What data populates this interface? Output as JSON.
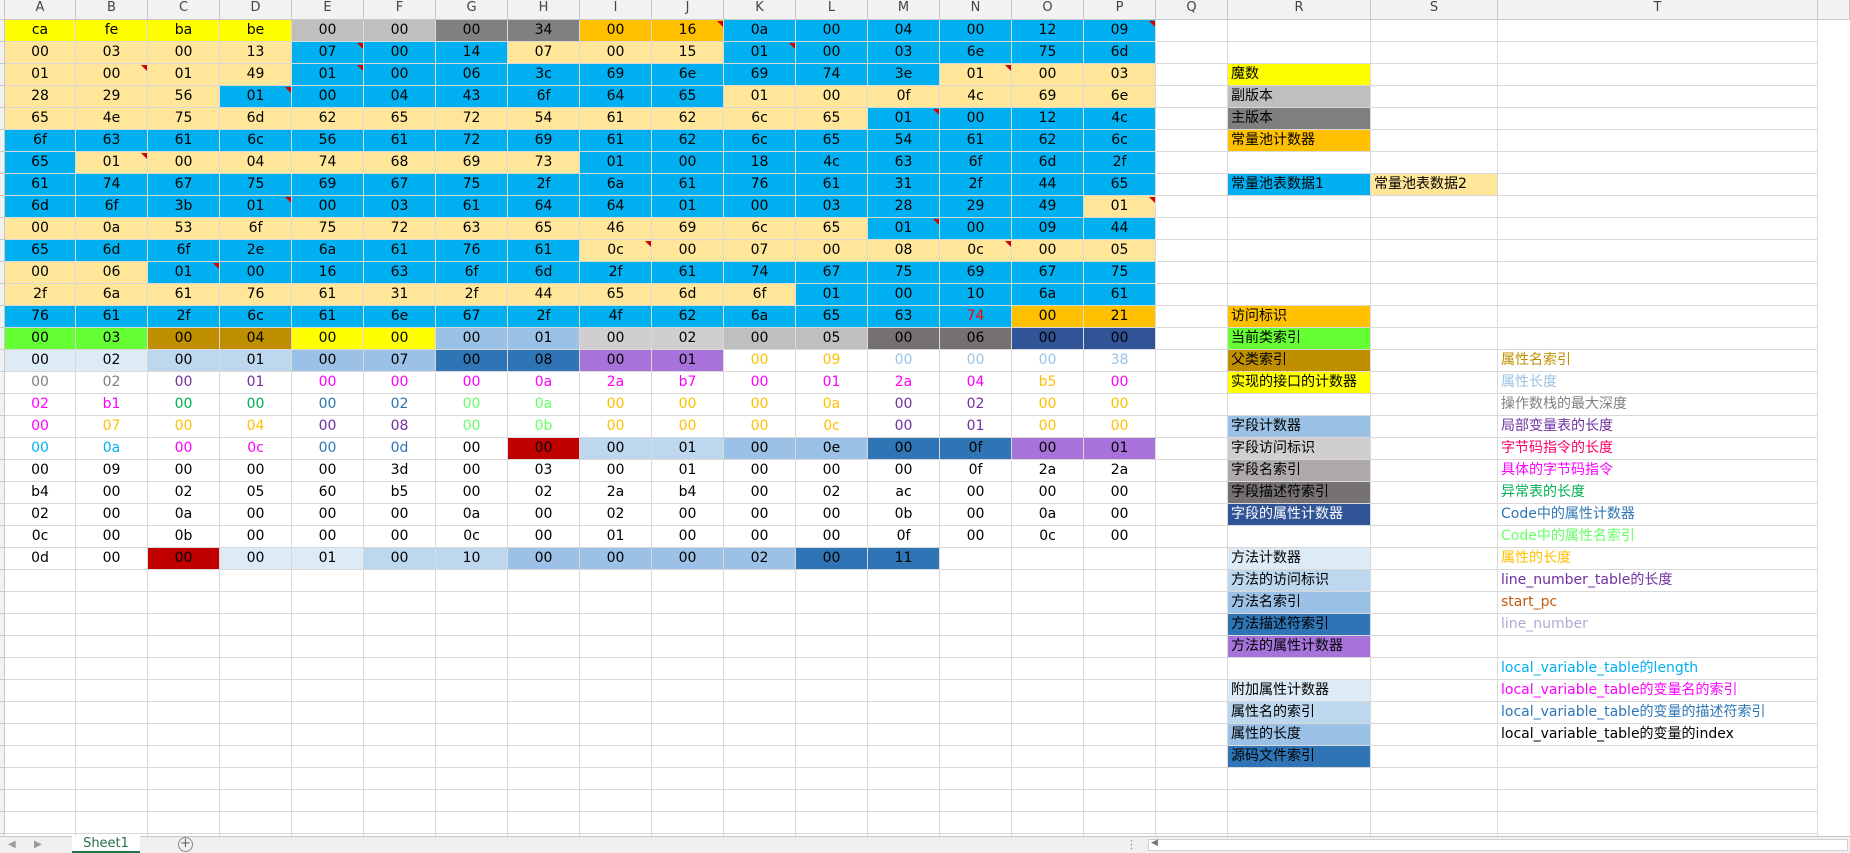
{
  "app": {
    "sheet_tab": "Sheet1",
    "add_sheet_icon": "+",
    "nav_prev_icon": "◀",
    "nav_next_icon": "▶",
    "scroll_dots": "⋮"
  },
  "columns": [
    "A",
    "B",
    "C",
    "D",
    "E",
    "F",
    "G",
    "H",
    "I",
    "J",
    "K",
    "L",
    "M",
    "N",
    "O",
    "P",
    "Q",
    "R",
    "S",
    "T"
  ],
  "grid": {
    "rows": [
      [
        "ca",
        "fe",
        "ba",
        "be",
        "00",
        "00",
        "00",
        "34",
        "00",
        "16",
        "0a",
        "00",
        "04",
        "00",
        "12",
        "09"
      ],
      [
        "00",
        "03",
        "00",
        "13",
        "07",
        "00",
        "14",
        "07",
        "00",
        "15",
        "01",
        "00",
        "03",
        "6e",
        "75",
        "6d"
      ],
      [
        "01",
        "00",
        "01",
        "49",
        "01",
        "00",
        "06",
        "3c",
        "69",
        "6e",
        "69",
        "74",
        "3e",
        "01",
        "00",
        "03"
      ],
      [
        "28",
        "29",
        "56",
        "01",
        "00",
        "04",
        "43",
        "6f",
        "64",
        "65",
        "01",
        "00",
        "0f",
        "4c",
        "69",
        "6e"
      ],
      [
        "65",
        "4e",
        "75",
        "6d",
        "62",
        "65",
        "72",
        "54",
        "61",
        "62",
        "6c",
        "65",
        "01",
        "00",
        "12",
        "4c"
      ],
      [
        "6f",
        "63",
        "61",
        "6c",
        "56",
        "61",
        "72",
        "69",
        "61",
        "62",
        "6c",
        "65",
        "54",
        "61",
        "62",
        "6c"
      ],
      [
        "65",
        "01",
        "00",
        "04",
        "74",
        "68",
        "69",
        "73",
        "01",
        "00",
        "18",
        "4c",
        "63",
        "6f",
        "6d",
        "2f"
      ],
      [
        "61",
        "74",
        "67",
        "75",
        "69",
        "67",
        "75",
        "2f",
        "6a",
        "61",
        "76",
        "61",
        "31",
        "2f",
        "44",
        "65"
      ],
      [
        "6d",
        "6f",
        "3b",
        "01",
        "00",
        "03",
        "61",
        "64",
        "64",
        "01",
        "00",
        "03",
        "28",
        "29",
        "49",
        "01"
      ],
      [
        "00",
        "0a",
        "53",
        "6f",
        "75",
        "72",
        "63",
        "65",
        "46",
        "69",
        "6c",
        "65",
        "01",
        "00",
        "09",
        "44"
      ],
      [
        "65",
        "6d",
        "6f",
        "2e",
        "6a",
        "61",
        "76",
        "61",
        "0c",
        "00",
        "07",
        "00",
        "08",
        "0c",
        "00",
        "05"
      ],
      [
        "00",
        "06",
        "01",
        "00",
        "16",
        "63",
        "6f",
        "6d",
        "2f",
        "61",
        "74",
        "67",
        "75",
        "69",
        "67",
        "75"
      ],
      [
        "2f",
        "6a",
        "61",
        "76",
        "61",
        "31",
        "2f",
        "44",
        "65",
        "6d",
        "6f",
        "01",
        "00",
        "10",
        "6a",
        "61"
      ],
      [
        "76",
        "61",
        "2f",
        "6c",
        "61",
        "6e",
        "67",
        "2f",
        "4f",
        "62",
        "6a",
        "65",
        "63",
        "74",
        "00",
        "21"
      ],
      [
        "00",
        "03",
        "00",
        "04",
        "00",
        "00",
        "00",
        "01",
        "00",
        "02",
        "00",
        "05",
        "00",
        "06",
        "00",
        "00"
      ],
      [
        "00",
        "02",
        "00",
        "01",
        "00",
        "07",
        "00",
        "08",
        "00",
        "01",
        "00",
        "09",
        "00",
        "00",
        "00",
        "38"
      ],
      [
        "00",
        "02",
        "00",
        "01",
        "00",
        "00",
        "00",
        "0a",
        "2a",
        "b7",
        "00",
        "01",
        "2a",
        "04",
        "b5",
        "00"
      ],
      [
        "02",
        "b1",
        "00",
        "00",
        "00",
        "02",
        "00",
        "0a",
        "00",
        "00",
        "00",
        "0a",
        "00",
        "02",
        "00",
        "00"
      ],
      [
        "00",
        "07",
        "00",
        "04",
        "00",
        "08",
        "00",
        "0b",
        "00",
        "00",
        "00",
        "0c",
        "00",
        "01",
        "00",
        "00"
      ],
      [
        "00",
        "0a",
        "00",
        "0c",
        "00",
        "0d",
        "00",
        "00",
        "00",
        "01",
        "00",
        "0e",
        "00",
        "0f",
        "00",
        "01"
      ],
      [
        "00",
        "09",
        "00",
        "00",
        "00",
        "3d",
        "00",
        "03",
        "00",
        "01",
        "00",
        "00",
        "00",
        "0f",
        "2a",
        "2a"
      ],
      [
        "b4",
        "00",
        "02",
        "05",
        "60",
        "b5",
        "00",
        "02",
        "2a",
        "b4",
        "00",
        "02",
        "ac",
        "00",
        "00",
        "00"
      ],
      [
        "02",
        "00",
        "0a",
        "00",
        "00",
        "00",
        "0a",
        "00",
        "02",
        "00",
        "00",
        "00",
        "0b",
        "00",
        "0a",
        "00"
      ],
      [
        "0c",
        "00",
        "0b",
        "00",
        "00",
        "00",
        "0c",
        "00",
        "01",
        "00",
        "00",
        "00",
        "0f",
        "00",
        "0c",
        "00"
      ],
      [
        "0d",
        "00",
        "00",
        "00",
        "01",
        "00",
        "10",
        "00",
        "00",
        "00",
        "02",
        "00",
        "11"
      ]
    ],
    "bg": [
      [
        "Y",
        "Y",
        "Y",
        "Y",
        "s",
        "s",
        "d",
        "d",
        "O",
        "O",
        "B",
        "B",
        "B",
        "B",
        "B",
        "B"
      ],
      [
        "P",
        "P",
        "P",
        "P",
        "B",
        "B",
        "B",
        "P",
        "P",
        "P",
        "B",
        "B",
        "B",
        "B",
        "B",
        "B"
      ],
      [
        "P",
        "P",
        "P",
        "P",
        "B",
        "B",
        "B",
        "B",
        "B",
        "B",
        "B",
        "B",
        "B",
        "P",
        "P",
        "P"
      ],
      [
        "P",
        "P",
        "P",
        "B",
        "B",
        "B",
        "B",
        "B",
        "B",
        "B",
        "P",
        "P",
        "P",
        "P",
        "P",
        "P"
      ],
      [
        "P",
        "P",
        "P",
        "P",
        "P",
        "P",
        "P",
        "P",
        "P",
        "P",
        "P",
        "P",
        "B",
        "B",
        "B",
        "B"
      ],
      [
        "B",
        "B",
        "B",
        "B",
        "B",
        "B",
        "B",
        "B",
        "B",
        "B",
        "B",
        "B",
        "B",
        "B",
        "B",
        "B"
      ],
      [
        "B",
        "P",
        "P",
        "P",
        "P",
        "P",
        "P",
        "P",
        "B",
        "B",
        "B",
        "B",
        "B",
        "B",
        "B",
        "B"
      ],
      [
        "B",
        "B",
        "B",
        "B",
        "B",
        "B",
        "B",
        "B",
        "B",
        "B",
        "B",
        "B",
        "B",
        "B",
        "B",
        "B"
      ],
      [
        "B",
        "B",
        "B",
        "B",
        "B",
        "B",
        "B",
        "B",
        "B",
        "B",
        "B",
        "B",
        "B",
        "B",
        "B",
        "P"
      ],
      [
        "P",
        "P",
        "P",
        "P",
        "P",
        "P",
        "P",
        "P",
        "P",
        "P",
        "P",
        "P",
        "B",
        "B",
        "B",
        "B"
      ],
      [
        "B",
        "B",
        "B",
        "B",
        "B",
        "B",
        "B",
        "B",
        "P",
        "P",
        "P",
        "P",
        "P",
        "P",
        "P",
        "P"
      ],
      [
        "P",
        "P",
        "B",
        "B",
        "B",
        "B",
        "B",
        "B",
        "B",
        "B",
        "B",
        "B",
        "B",
        "B",
        "B",
        "B"
      ],
      [
        "P",
        "P",
        "P",
        "P",
        "P",
        "P",
        "P",
        "P",
        "P",
        "P",
        "P",
        "B",
        "B",
        "B",
        "B",
        "B"
      ],
      [
        "B",
        "B",
        "B",
        "B",
        "B",
        "B",
        "B",
        "B",
        "B",
        "B",
        "B",
        "B",
        "B",
        "B",
        "O",
        "O"
      ],
      [
        "G",
        "G",
        "K",
        "K",
        "Y",
        "Y",
        "lb",
        "lb",
        "ls",
        "ls",
        "s",
        "s",
        "dg",
        "dg",
        "nv",
        "nv"
      ],
      [
        "pb",
        "pb",
        "lb2",
        "lb2",
        "mb",
        "mb",
        "db",
        "db",
        "pu",
        "pu",
        "w",
        "w",
        "w",
        "w",
        "w",
        "w"
      ],
      [
        "w",
        "w",
        "w",
        "w",
        "w",
        "w",
        "w",
        "w",
        "w",
        "w",
        "w",
        "w",
        "w",
        "w",
        "w",
        "w"
      ],
      [
        "w",
        "w",
        "w",
        "w",
        "w",
        "w",
        "w",
        "w",
        "w",
        "w",
        "w",
        "w",
        "w",
        "w",
        "w",
        "w"
      ],
      [
        "w",
        "w",
        "w",
        "w",
        "w",
        "w",
        "w",
        "w",
        "w",
        "w",
        "w",
        "w",
        "w",
        "w",
        "w",
        "w"
      ],
      [
        "w",
        "w",
        "w",
        "w",
        "w",
        "w",
        "w",
        "R",
        "lb2",
        "lb2",
        "mb",
        "mb",
        "db",
        "db",
        "pu",
        "pu"
      ],
      [
        "w",
        "w",
        "w",
        "w",
        "w",
        "w",
        "w",
        "w",
        "w",
        "w",
        "w",
        "w",
        "w",
        "w",
        "w",
        "w"
      ],
      [
        "w",
        "w",
        "w",
        "w",
        "w",
        "w",
        "w",
        "w",
        "w",
        "w",
        "w",
        "w",
        "w",
        "w",
        "w",
        "w"
      ],
      [
        "w",
        "w",
        "w",
        "w",
        "w",
        "w",
        "w",
        "w",
        "w",
        "w",
        "w",
        "w",
        "w",
        "w",
        "w",
        "w"
      ],
      [
        "w",
        "w",
        "w",
        "w",
        "w",
        "w",
        "w",
        "w",
        "w",
        "w",
        "w",
        "w",
        "w",
        "w",
        "w",
        "w"
      ],
      [
        "w",
        "w",
        "R",
        "pb",
        "pb",
        "lb2",
        "lb2",
        "mb",
        "mb",
        "mb",
        "mb",
        "db",
        "db"
      ]
    ],
    "fg": [
      [],
      [],
      [],
      [],
      [],
      [],
      [],
      [],
      [],
      [],
      [],
      [],
      [],
      [
        "k",
        "k",
        "k",
        "k",
        "k",
        "k",
        "k",
        "k",
        "k",
        "k",
        "k",
        "k",
        "k",
        "r",
        "k",
        "k"
      ],
      [],
      [
        "k",
        "k",
        "k",
        "k",
        "k",
        "k",
        "k",
        "k",
        "k",
        "k",
        "gd",
        "gd",
        "pr",
        "pr",
        "pr",
        "pr"
      ],
      [
        "gy",
        "gy",
        "pu",
        "pu",
        "mg",
        "mg",
        "mg",
        "mg",
        "mg",
        "mg",
        "mg",
        "mg",
        "mg",
        "mg",
        "gd",
        "mg"
      ],
      [
        "mg",
        "mg",
        "gr",
        "gr",
        "bl",
        "bl",
        "lg",
        "lg",
        "gd",
        "gd",
        "gd",
        "gd",
        "pu",
        "pu",
        "gd",
        "gd"
      ],
      [
        "mg",
        "gd",
        "gd",
        "gd",
        "pu",
        "pu",
        "lg",
        "lg",
        "gd",
        "gd",
        "gd",
        "gd",
        "pu",
        "pu",
        "gd",
        "gd"
      ],
      [
        "cy",
        "cy",
        "mg",
        "mg",
        "bl",
        "bl",
        "k",
        "k",
        "k",
        "k",
        "k",
        "k",
        "k",
        "k",
        "k",
        "k"
      ],
      [],
      [],
      [],
      [],
      []
    ]
  },
  "comments": [
    [
      0,
      9
    ],
    [
      0,
      15
    ],
    [
      1,
      4
    ],
    [
      1,
      10
    ],
    [
      2,
      1
    ],
    [
      2,
      4
    ],
    [
      2,
      13
    ],
    [
      3,
      3
    ],
    [
      4,
      12
    ],
    [
      6,
      1
    ],
    [
      8,
      3
    ],
    [
      8,
      15
    ],
    [
      9,
      12
    ],
    [
      10,
      8
    ],
    [
      10,
      13
    ],
    [
      11,
      2
    ]
  ],
  "legend_col_r": [
    {
      "text": "魔数",
      "bg": "#ffff00",
      "fg": "#000000"
    },
    {
      "text": "副版本",
      "bg": "#bfbfbf",
      "fg": "#000000"
    },
    {
      "text": "主版本",
      "bg": "#7f7f7f",
      "fg": "#000000"
    },
    {
      "text": "常量池计数器",
      "bg": "#ffc000",
      "fg": "#000000"
    },
    {
      "text": "常量池表数据1",
      "bg": "#00b0f0",
      "fg": "#000000"
    },
    {
      "text": "访问标识",
      "bg": "#ffc000",
      "fg": "#000000"
    },
    {
      "text": "当前类索引",
      "bg": "#66ff33",
      "fg": "#000000"
    },
    {
      "text": "父类索引",
      "bg": "#bf8f00",
      "fg": "#000000"
    },
    {
      "text": "实现的接口的计数器",
      "bg": "#ffff00",
      "fg": "#000000"
    },
    {
      "text": "字段计数器",
      "bg": "#9bc2e6",
      "fg": "#000000"
    },
    {
      "text": "字段访问标识",
      "bg": "#d0cece",
      "fg": "#000000"
    },
    {
      "text": "字段名索引",
      "bg": "#aeaaaa",
      "fg": "#000000"
    },
    {
      "text": "字段描述符索引",
      "bg": "#757171",
      "fg": "#000000"
    },
    {
      "text": "字段的属性计数器",
      "bg": "#305496",
      "fg": "#ffffff"
    },
    {
      "text": "方法计数器",
      "bg": "#ddebf7",
      "fg": "#000000"
    },
    {
      "text": "方法的访问标识",
      "bg": "#bdd7ee",
      "fg": "#000000"
    },
    {
      "text": "方法名索引",
      "bg": "#9bc2e6",
      "fg": "#000000"
    },
    {
      "text": "方法描述符索引",
      "bg": "#2f75b5",
      "fg": "#000000"
    },
    {
      "text": "方法的属性计数器",
      "bg": "#a773db",
      "fg": "#000000"
    },
    {
      "text": "附加属性计数器",
      "bg": "#ddebf7",
      "fg": "#000000"
    },
    {
      "text": "属性名的索引",
      "bg": "#bdd7ee",
      "fg": "#000000"
    },
    {
      "text": "属性的长度",
      "bg": "#9bc2e6",
      "fg": "#000000"
    },
    {
      "text": "源码文件索引",
      "bg": "#2f75b5",
      "fg": "#000000"
    }
  ],
  "legend_col_s": {
    "text": "常量池表数据2",
    "bg": "#ffe699",
    "fg": "#000000"
  },
  "legend_col_t": [
    {
      "text": "属性名索引",
      "fg": "#bf8f00"
    },
    {
      "text": "属性长度",
      "fg": "#9bc2e6"
    },
    {
      "text": "操作数栈的最大深度",
      "fg": "#808080"
    },
    {
      "text": "局部变量表的长度",
      "fg": "#7030a0"
    },
    {
      "text": "字节码指令的长度",
      "fg": "#ff0066"
    },
    {
      "text": "具体的字节码指令",
      "fg": "#ff00ff"
    },
    {
      "text": "异常表的长度",
      "fg": "#00b050"
    },
    {
      "text": "Code中的属性计数器",
      "fg": "#2f75b5"
    },
    {
      "text": "Code中的属性名索引",
      "fg": "#66ff66"
    },
    {
      "text": "属性的长度",
      "fg": "#ffc000"
    },
    {
      "text": "line_number_table的长度",
      "fg": "#7030a0"
    },
    {
      "text": "start_pc",
      "fg": "#c55a11"
    },
    {
      "text": "line_number",
      "fg": "#b4a7d6"
    },
    {
      "text": "local_variable_table的length",
      "fg": "#00b0f0"
    },
    {
      "text": "local_variable_table的变量名的索引",
      "fg": "#ff00ff"
    },
    {
      "text": "local_variable_table的变量的描述符索引",
      "fg": "#2f75b5"
    },
    {
      "text": "local_variable_table的变量的index",
      "fg": "#000000"
    }
  ],
  "colors": {
    "Y": "#ffff00",
    "s": "#bfbfbf",
    "d": "#808080",
    "O": "#ffc000",
    "B": "#00b0f0",
    "P": "#ffe699",
    "G": "#66ff33",
    "K": "#bf8f00",
    "lb": "#9bc2e6",
    "ls": "#d0cece",
    "dg": "#757171",
    "nv": "#305496",
    "pb": "#ddebf7",
    "lb2": "#bdd7ee",
    "mb": "#9bc2e6",
    "db": "#2f75b5",
    "pu": "#a773db",
    "R": "#c00000",
    "w": "#ffffff",
    "fk": "#000000",
    "fr": "#ff0000",
    "fgy": "#7f7f7f",
    "fpu": "#7030a0",
    "fmg": "#ff00ff",
    "fgr": "#00b050",
    "fbl": "#2f75b5",
    "flg": "#66ff66",
    "fgd": "#ffc000",
    "fcy": "#00b0f0",
    "fpr": "#9bc2e6"
  }
}
